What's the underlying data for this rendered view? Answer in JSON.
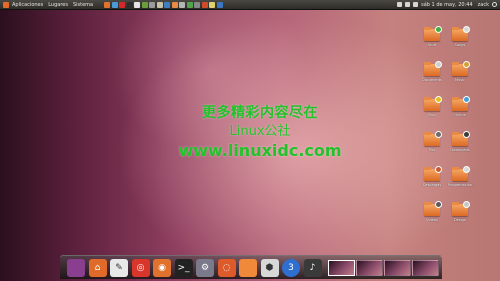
{
  "panel": {
    "menus": [
      "Aplicaciones",
      "Lugares",
      "Sistema"
    ],
    "launchers": [
      {
        "name": "firefox-icon",
        "color": "#e0722d"
      },
      {
        "name": "chrome-icon",
        "color": "#4a9bd6"
      },
      {
        "name": "opera-icon",
        "color": "#d6282a"
      },
      {
        "name": "terminal-icon",
        "color": "#2d2d2d"
      },
      {
        "name": "text-editor-icon",
        "color": "#e5e5e5"
      },
      {
        "name": "photo-viewer-icon",
        "color": "#6b9e3b"
      },
      {
        "name": "settings-icon",
        "color": "#9a9a9a"
      },
      {
        "name": "mail-icon",
        "color": "#c9c0a8"
      },
      {
        "name": "media-player-icon",
        "color": "#3f7fc0"
      },
      {
        "name": "home-folder-icon",
        "color": "#e98b45"
      },
      {
        "name": "network-icon",
        "color": "#b5b5b5"
      },
      {
        "name": "chat-icon",
        "color": "#54a34a"
      },
      {
        "name": "audio-icon",
        "color": "#888888"
      },
      {
        "name": "update-icon",
        "color": "#d04b2a"
      },
      {
        "name": "notes-icon",
        "color": "#e0d070"
      },
      {
        "name": "help-icon",
        "color": "#3b76c2"
      }
    ],
    "clock": "sáb 1 de may, 20:44",
    "user": "zack"
  },
  "desktop_icons": [
    {
      "name": "Stuff",
      "emblem": "#3fae3a"
    },
    {
      "name": "Songs",
      "emblem": "#d8d8d8"
    },
    {
      "name": "Documents",
      "emblem": "#cfcfcf"
    },
    {
      "name": "Music",
      "emblem": "#d4a030"
    },
    {
      "name": "Pool",
      "emblem": "#e0c020"
    },
    {
      "name": "Online",
      "emblem": "#4aa0d8"
    },
    {
      "name": "Pics",
      "emblem": "#6a6a6a"
    },
    {
      "name": "Downloads",
      "emblem": "#3a3a3a"
    },
    {
      "name": "Descargas",
      "emblem": "#c85a30"
    },
    {
      "name": "Programación",
      "emblem": "#d8d8d8"
    },
    {
      "name": "Videos",
      "emblem": "#5a5a5a"
    },
    {
      "name": "Design",
      "emblem": "#c8c8c8"
    }
  ],
  "watermark": {
    "line1": "更多精彩内容尽在",
    "line2": "Linux公社",
    "line3": "www.linuxidc.com"
  },
  "dock": {
    "items": [
      {
        "name": "show-desktop-icon",
        "color": "#8a3e8f",
        "glyph": ""
      },
      {
        "name": "home-icon",
        "color": "#e06a2a",
        "glyph": "⌂"
      },
      {
        "name": "text-editor-icon",
        "color": "#e8e8e8",
        "glyph": "✎"
      },
      {
        "name": "chrome-icon",
        "color": "#d8362b",
        "glyph": "◎"
      },
      {
        "name": "firefox-icon",
        "color": "#e0722d",
        "glyph": "◉"
      },
      {
        "name": "terminal-icon",
        "color": "#222222",
        "glyph": ">_"
      },
      {
        "name": "settings-icon",
        "color": "#7a7a8a",
        "glyph": "⚙"
      },
      {
        "name": "ubuntu-icon",
        "color": "#dd5a2a",
        "glyph": "◌"
      },
      {
        "name": "files-icon",
        "color": "#f08a3a",
        "glyph": ""
      },
      {
        "name": "software-center-icon",
        "color": "#d8d8d8",
        "glyph": "⬢"
      },
      {
        "name": "workspace-badge-icon",
        "color": "#2f6fd0",
        "glyph": "3"
      },
      {
        "name": "music-player-icon",
        "color": "#3a3a3a",
        "glyph": "♪"
      }
    ],
    "workspaces": 4
  }
}
